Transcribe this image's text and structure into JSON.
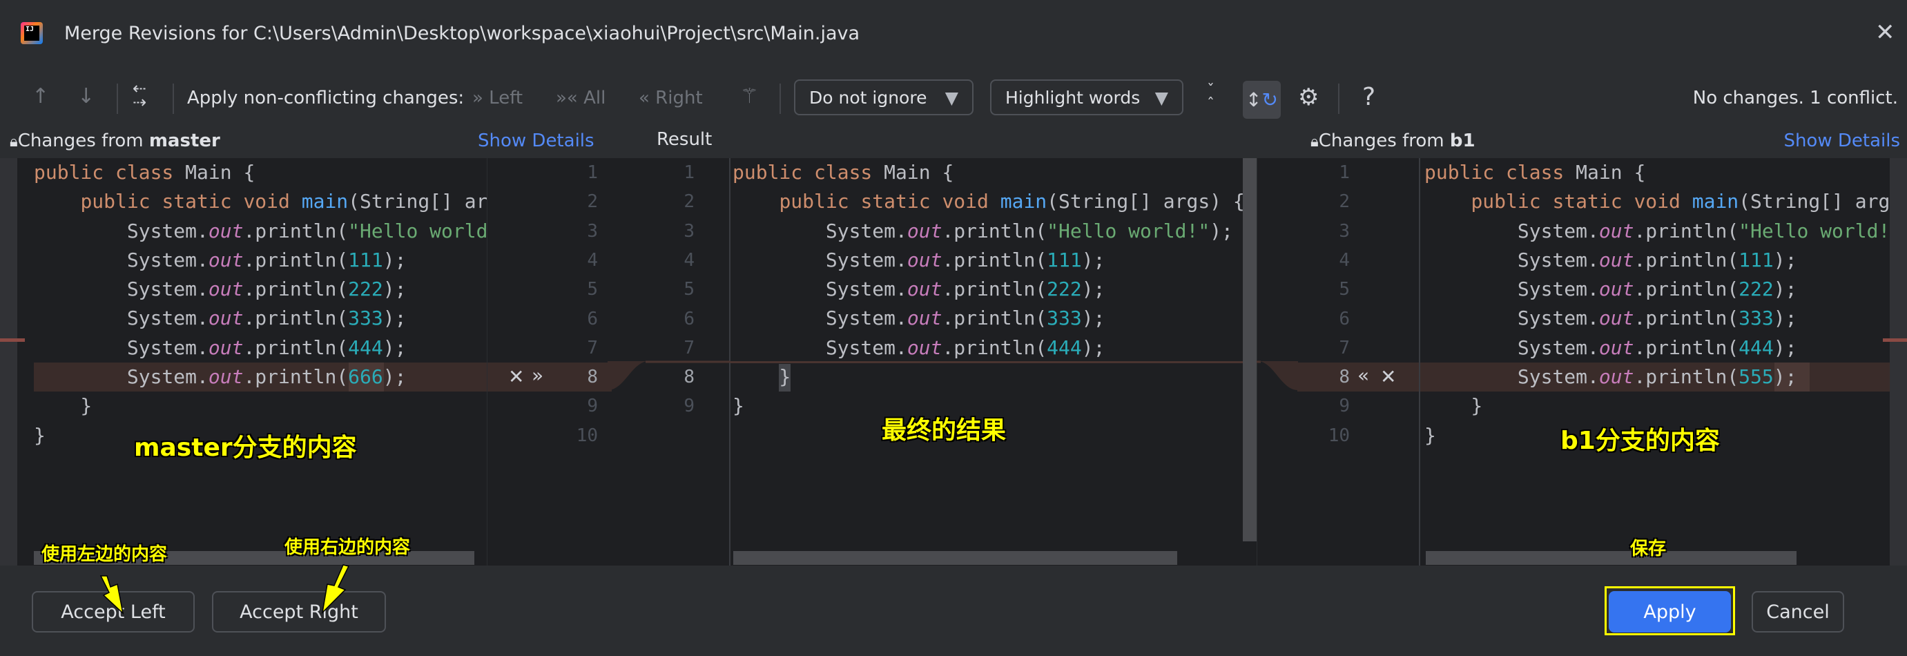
{
  "window": {
    "title": "Merge Revisions for C:\\Users\\Admin\\Desktop\\workspace\\xiaohui\\Project\\src\\Main.java",
    "close_icon": "close-icon",
    "app_icon": "intellij-idea-icon"
  },
  "toolbar": {
    "apply_label": "Apply non-conflicting changes:",
    "left": "Left",
    "all": "All",
    "right": "Right",
    "ignore_select": "Do not ignore",
    "highlight_select": "Highlight words",
    "help": "?",
    "status": "No changes. 1 conflict."
  },
  "panels": {
    "left": {
      "title_prefix": "Changes from ",
      "branch": "master",
      "details": "Show Details"
    },
    "middle": {
      "title": "Result"
    },
    "right": {
      "title_prefix": "Changes from ",
      "branch": "b1",
      "details": "Show Details"
    }
  },
  "code": {
    "left": [
      [
        [
          "kw",
          "public class "
        ],
        [
          "pl",
          "Main {"
        ]
      ],
      [
        [
          "pl",
          "    "
        ],
        [
          "kw",
          "public static void "
        ],
        [
          "fn",
          "main"
        ],
        [
          "pl",
          "(String[] args) {"
        ]
      ],
      [
        [
          "pl",
          "        System."
        ],
        [
          "fld",
          "out"
        ],
        [
          "pl",
          ".println("
        ],
        [
          "str",
          "\"Hello world!\""
        ],
        [
          "pl",
          ");"
        ]
      ],
      [
        [
          "pl",
          "        System."
        ],
        [
          "fld",
          "out"
        ],
        [
          "pl",
          ".println("
        ],
        [
          "num",
          "111"
        ],
        [
          "pl",
          ");"
        ]
      ],
      [
        [
          "pl",
          "        System."
        ],
        [
          "fld",
          "out"
        ],
        [
          "pl",
          ".println("
        ],
        [
          "num",
          "222"
        ],
        [
          "pl",
          ");"
        ]
      ],
      [
        [
          "pl",
          "        System."
        ],
        [
          "fld",
          "out"
        ],
        [
          "pl",
          ".println("
        ],
        [
          "num",
          "333"
        ],
        [
          "pl",
          ");"
        ]
      ],
      [
        [
          "pl",
          "        System."
        ],
        [
          "fld",
          "out"
        ],
        [
          "pl",
          ".println("
        ],
        [
          "num",
          "444"
        ],
        [
          "pl",
          ");"
        ]
      ],
      [
        [
          "pl",
          "        System."
        ],
        [
          "fld",
          "out"
        ],
        [
          "pl",
          ".println("
        ],
        [
          "num",
          "666"
        ],
        [
          "pl",
          ");"
        ]
      ],
      [
        [
          "pl",
          "    }"
        ]
      ],
      [
        [
          "pl",
          "}"
        ]
      ]
    ],
    "middle": [
      [
        [
          "kw",
          "public class "
        ],
        [
          "pl",
          "Main {"
        ]
      ],
      [
        [
          "pl",
          "    "
        ],
        [
          "kw",
          "public static void "
        ],
        [
          "fn",
          "main"
        ],
        [
          "pl",
          "(String[] args) {"
        ]
      ],
      [
        [
          "pl",
          "        System."
        ],
        [
          "fld",
          "out"
        ],
        [
          "pl",
          ".println("
        ],
        [
          "str",
          "\"Hello world!\""
        ],
        [
          "pl",
          ");"
        ]
      ],
      [
        [
          "pl",
          "        System."
        ],
        [
          "fld",
          "out"
        ],
        [
          "pl",
          ".println("
        ],
        [
          "num",
          "111"
        ],
        [
          "pl",
          ");"
        ]
      ],
      [
        [
          "pl",
          "        System."
        ],
        [
          "fld",
          "out"
        ],
        [
          "pl",
          ".println("
        ],
        [
          "num",
          "222"
        ],
        [
          "pl",
          ");"
        ]
      ],
      [
        [
          "pl",
          "        System."
        ],
        [
          "fld",
          "out"
        ],
        [
          "pl",
          ".println("
        ],
        [
          "num",
          "333"
        ],
        [
          "pl",
          ");"
        ]
      ],
      [
        [
          "pl",
          "        System."
        ],
        [
          "fld",
          "out"
        ],
        [
          "pl",
          ".println("
        ],
        [
          "num",
          "444"
        ],
        [
          "pl",
          ");"
        ]
      ],
      [
        [
          "pl",
          "    }"
        ]
      ],
      [
        [
          "pl",
          "}"
        ]
      ]
    ],
    "right": [
      [
        [
          "kw",
          "public class "
        ],
        [
          "pl",
          "Main {"
        ]
      ],
      [
        [
          "pl",
          "    "
        ],
        [
          "kw",
          "public static void "
        ],
        [
          "fn",
          "main"
        ],
        [
          "pl",
          "(String[] args) {"
        ]
      ],
      [
        [
          "pl",
          "        System."
        ],
        [
          "fld",
          "out"
        ],
        [
          "pl",
          ".println("
        ],
        [
          "str",
          "\"Hello world!\""
        ],
        [
          "pl",
          ");"
        ]
      ],
      [
        [
          "pl",
          "        System."
        ],
        [
          "fld",
          "out"
        ],
        [
          "pl",
          ".println("
        ],
        [
          "num",
          "111"
        ],
        [
          "pl",
          ");"
        ]
      ],
      [
        [
          "pl",
          "        System."
        ],
        [
          "fld",
          "out"
        ],
        [
          "pl",
          ".println("
        ],
        [
          "num",
          "222"
        ],
        [
          "pl",
          ");"
        ]
      ],
      [
        [
          "pl",
          "        System."
        ],
        [
          "fld",
          "out"
        ],
        [
          "pl",
          ".println("
        ],
        [
          "num",
          "333"
        ],
        [
          "pl",
          ");"
        ]
      ],
      [
        [
          "pl",
          "        System."
        ],
        [
          "fld",
          "out"
        ],
        [
          "pl",
          ".println("
        ],
        [
          "num",
          "444"
        ],
        [
          "pl",
          ");"
        ]
      ],
      [
        [
          "pl",
          "        System."
        ],
        [
          "fld",
          "out"
        ],
        [
          "pl",
          ".println("
        ],
        [
          "num",
          "555"
        ],
        [
          "pl",
          ");"
        ]
      ],
      [
        [
          "pl",
          "    }"
        ]
      ],
      [
        [
          "pl",
          "}"
        ]
      ]
    ],
    "left_numbers": [
      "1",
      "2",
      "3",
      "4",
      "5",
      "6",
      "7",
      "8",
      "9",
      "10"
    ],
    "middle_numbers": [
      "1",
      "2",
      "3",
      "4",
      "5",
      "6",
      "7",
      "8",
      "9"
    ],
    "right_numbers": [
      "1",
      "2",
      "3",
      "4",
      "5",
      "6",
      "7",
      "8",
      "9",
      "10"
    ]
  },
  "annotations": {
    "left": "master分支的内容",
    "middle": "最终的结果",
    "right": "b1分支的内容",
    "accept_left": "使用左边的内容",
    "accept_right": "使用右边的内容",
    "apply": "保存"
  },
  "footer": {
    "accept_left": "Accept Left",
    "accept_right": "Accept Right",
    "apply": "Apply",
    "cancel": "Cancel"
  },
  "colors": {
    "accent": "#3574f0",
    "link": "#548af7",
    "conflict": "#3a2c2a",
    "annotation": "#ffff00"
  }
}
